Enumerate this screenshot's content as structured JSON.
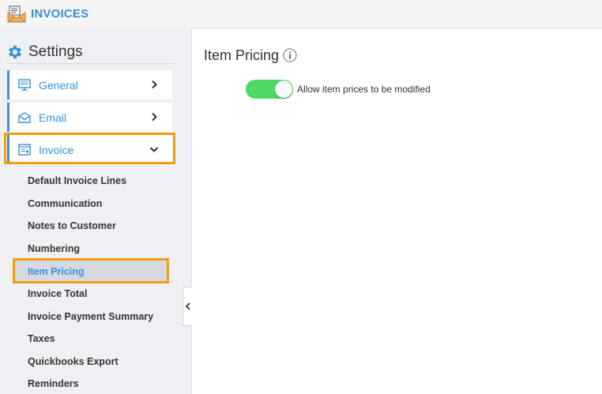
{
  "app": {
    "title": "INVOICES",
    "logo_icon": "envelope-invoice-icon"
  },
  "colors": {
    "accent": "#3b8fd9",
    "highlight": "#f39c12",
    "toggle_on": "#4cd964"
  },
  "sidebar": {
    "header": {
      "title": "Settings",
      "icon": "gear-icon"
    },
    "items": [
      {
        "label": "General",
        "icon": "monitor-icon",
        "chevron": "chevron-right-icon"
      },
      {
        "label": "Email",
        "icon": "envelope-icon",
        "chevron": "chevron-right-icon"
      },
      {
        "label": "Invoice",
        "icon": "invoice-icon",
        "chevron": "chevron-down-icon",
        "expanded": true
      }
    ],
    "sub_items": [
      "Default Invoice Lines",
      "Communication",
      "Notes to Customer",
      "Numbering",
      "Item Pricing",
      "Invoice Total",
      "Invoice Payment Summary",
      "Taxes",
      "Quickbooks Export",
      "Reminders"
    ],
    "active_sub_item": "Item Pricing",
    "collapse_icon": "chevron-left-icon"
  },
  "main": {
    "title": "Item Pricing",
    "info_icon": "info-icon",
    "toggle": {
      "label": "Allow item prices to be modified",
      "on": true
    }
  }
}
